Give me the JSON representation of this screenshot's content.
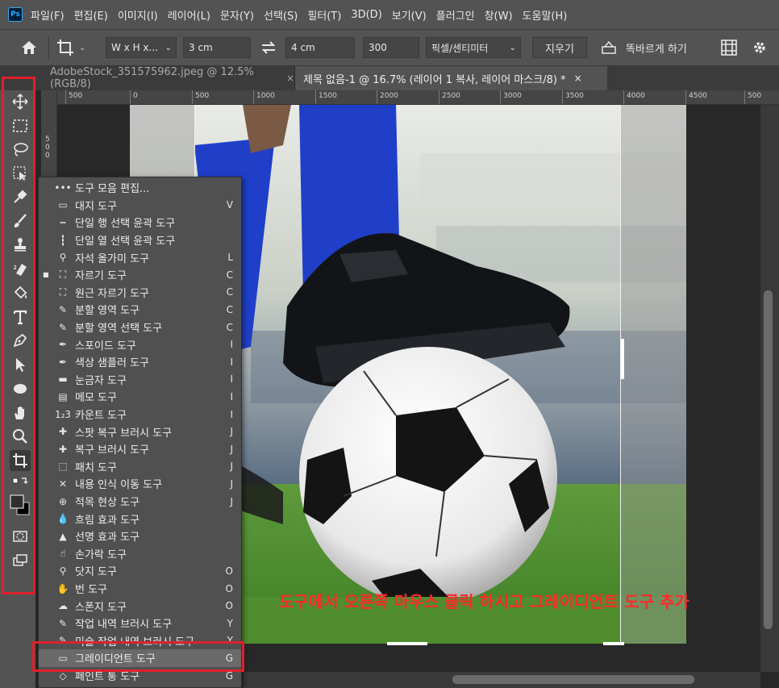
{
  "app": {
    "logo": "Ps"
  },
  "menubar": {
    "items": [
      "파일(F)",
      "편집(E)",
      "이미지(I)",
      "레이어(L)",
      "문자(Y)",
      "선택(S)",
      "필터(T)",
      "3D(D)",
      "보기(V)",
      "플러그인",
      "창(W)",
      "도움말(H)"
    ]
  },
  "options": {
    "ratio_select": "W x H x...",
    "width_value": "3 cm",
    "height_value": "4 cm",
    "resolution_value": "300",
    "unit_select": "픽셀/센티미터",
    "clear_label": "지우기",
    "straighten_label": "똑바르게 하기",
    "icons": {
      "home": "home-icon",
      "crop": "crop-icon",
      "swap": "swap-icon",
      "grid": "grid-icon",
      "gear": "gear-icon"
    }
  },
  "tabs": [
    {
      "label": "AdobeStock_351575962.jpeg @ 12.5% (RGB/8)",
      "close": "×",
      "active": false
    },
    {
      "label": "제목 없음-1 @ 16.7% (레이어 1 복사, 레이어 마스크/8) *",
      "close": "×",
      "active": true
    }
  ],
  "ruler": {
    "top_labels": [
      "500",
      "0",
      "500",
      "1000",
      "1500",
      "2000",
      "2500",
      "3000",
      "3500",
      "4000",
      "4500",
      "500"
    ],
    "left_labels": [
      "5",
      "0",
      "0"
    ]
  },
  "toolbar": {
    "collapse": "»",
    "tools": [
      "move-icon",
      "marquee-icon",
      "lasso-icon",
      "object-select-icon",
      "eyedropper-icon",
      "brush-icon",
      "stamp-icon",
      "eraser-icon",
      "paint-bucket-icon",
      "type-icon",
      "pen-icon",
      "path-select-icon",
      "ellipse-icon",
      "hand-icon",
      "zoom-icon",
      "crop-icon",
      "swap-colors-icon",
      "color-swatch-icon",
      "quick-mask-icon",
      "screen-mode-icon"
    ]
  },
  "context_menu": {
    "items": [
      {
        "label": "도구 모음 편집...",
        "key": "",
        "icon": "•••",
        "current": false
      },
      {
        "label": "대지 도구",
        "key": "V",
        "icon": "▭",
        "current": false
      },
      {
        "label": "단일 행 선택 윤곽 도구",
        "key": "",
        "icon": "┅",
        "current": false
      },
      {
        "label": "단일 열 선택 윤곽 도구",
        "key": "",
        "icon": "┇",
        "current": false
      },
      {
        "label": "자석 올가미 도구",
        "key": "L",
        "icon": "⚲",
        "current": false
      },
      {
        "label": "자르기 도구",
        "key": "C",
        "icon": "⛶",
        "current": true
      },
      {
        "label": "원근 자르기 도구",
        "key": "C",
        "icon": "⛶",
        "current": false
      },
      {
        "label": "분할 영역 도구",
        "key": "C",
        "icon": "✎",
        "current": false
      },
      {
        "label": "분할 영역 선택 도구",
        "key": "C",
        "icon": "✎",
        "current": false
      },
      {
        "label": "스포이드 도구",
        "key": "I",
        "icon": "✒",
        "current": false
      },
      {
        "label": "색상 샘플러 도구",
        "key": "I",
        "icon": "✒",
        "current": false
      },
      {
        "label": "눈금자 도구",
        "key": "I",
        "icon": "▬",
        "current": false
      },
      {
        "label": "메모 도구",
        "key": "I",
        "icon": "▤",
        "current": false
      },
      {
        "label": "카운트 도구",
        "key": "I",
        "icon": "1₂3",
        "current": false
      },
      {
        "label": "스팟 복구 브러시 도구",
        "key": "J",
        "icon": "✚",
        "current": false
      },
      {
        "label": "복구 브러시 도구",
        "key": "J",
        "icon": "✚",
        "current": false
      },
      {
        "label": "패치 도구",
        "key": "J",
        "icon": "⬚",
        "current": false
      },
      {
        "label": "내용 인식 이동 도구",
        "key": "J",
        "icon": "✕",
        "current": false
      },
      {
        "label": "적목 현상 도구",
        "key": "J",
        "icon": "⊕",
        "current": false
      },
      {
        "label": "흐림 효과 도구",
        "key": "",
        "icon": "💧",
        "current": false
      },
      {
        "label": "선명 효과 도구",
        "key": "",
        "icon": "▲",
        "current": false
      },
      {
        "label": "손가락 도구",
        "key": "",
        "icon": "☝",
        "current": false
      },
      {
        "label": "닷지 도구",
        "key": "O",
        "icon": "⚲",
        "current": false
      },
      {
        "label": "번 도구",
        "key": "O",
        "icon": "✋",
        "current": false
      },
      {
        "label": "스폰지 도구",
        "key": "O",
        "icon": "☁",
        "current": false
      },
      {
        "label": "작업 내역 브러시 도구",
        "key": "Y",
        "icon": "✎",
        "current": false
      },
      {
        "label": "미술 작업 내역 브러시 도구",
        "key": "Y",
        "icon": "✎",
        "current": false
      },
      {
        "label": "그레이디언트 도구",
        "key": "G",
        "icon": "▭",
        "current": false,
        "highlighted": true
      },
      {
        "label": "페인트 통 도구",
        "key": "G",
        "icon": "◇",
        "current": false
      }
    ]
  },
  "annotation": {
    "text": "도구에서 오른쪽 마우스 클릭 하시고 그레이디언트 도구 추가"
  }
}
